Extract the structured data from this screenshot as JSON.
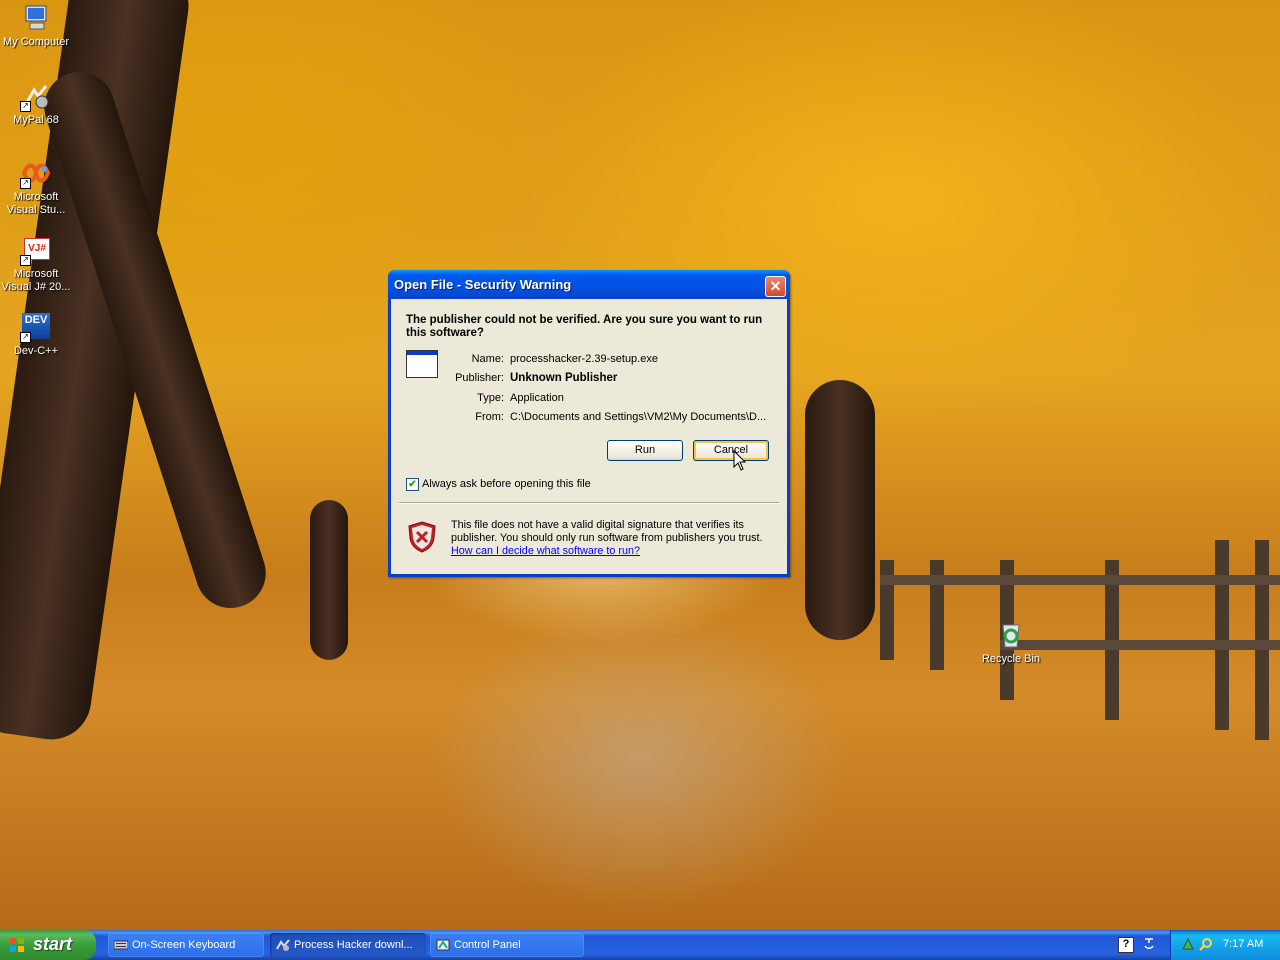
{
  "desktop": {
    "icons": [
      {
        "label": "My Computer",
        "icon": "my-computer-icon"
      },
      {
        "label": "MyPal 68",
        "icon": "mypal-icon"
      },
      {
        "label": "Microsoft Visual Stu...",
        "icon": "visual-studio-icon"
      },
      {
        "label": "Microsoft Visual J# 20...",
        "icon": "visual-jsharp-icon"
      },
      {
        "label": "Dev-C++",
        "icon": "devcpp-icon"
      },
      {
        "label": "Recycle Bin",
        "icon": "recycle-bin-icon"
      }
    ],
    "icon_badges": {
      "vj": "VJ#",
      "dev": "DEV"
    }
  },
  "dialog": {
    "title": "Open File - Security Warning",
    "close_glyph": "✕",
    "question": "The publisher could not be verified.  Are you sure you want to run this software?",
    "fields": [
      {
        "label": "Name:",
        "value": "processhacker-2.39-setup.exe",
        "bold": false
      },
      {
        "label": "Publisher:",
        "value": "Unknown Publisher",
        "bold": true
      },
      {
        "label": "Type:",
        "value": "Application",
        "bold": false
      },
      {
        "label": "From:",
        "value": "C:\\Documents and Settings\\VM2\\My Documents\\D...",
        "bold": false
      }
    ],
    "run_label": "Run",
    "cancel_label": "Cancel",
    "always_ask_label": "Always ask before opening this file",
    "always_ask_checked": true,
    "check_glyph": "✔",
    "warning_text": "This file does not have a valid digital signature that verifies its publisher.  You should only run software from publishers you trust.",
    "warning_link": "How can I decide what software to run?"
  },
  "taskbar": {
    "start_label": "start",
    "tasks": [
      {
        "label": "On-Screen Keyboard",
        "icon": "keyboard-icon",
        "active": false
      },
      {
        "label": "Process Hacker downl...",
        "icon": "mypal-icon",
        "active": true
      },
      {
        "label": "Control Panel",
        "icon": "control-panel-icon",
        "active": false
      }
    ],
    "clock": "7:17 AM",
    "help_glyph": "?"
  },
  "colors": {
    "title_blue": "#0055ea",
    "dialog_bg": "#ece9d8",
    "start_green": "#389d38",
    "taskbar_blue": "#2663e0",
    "link_blue": "#0000ff"
  }
}
